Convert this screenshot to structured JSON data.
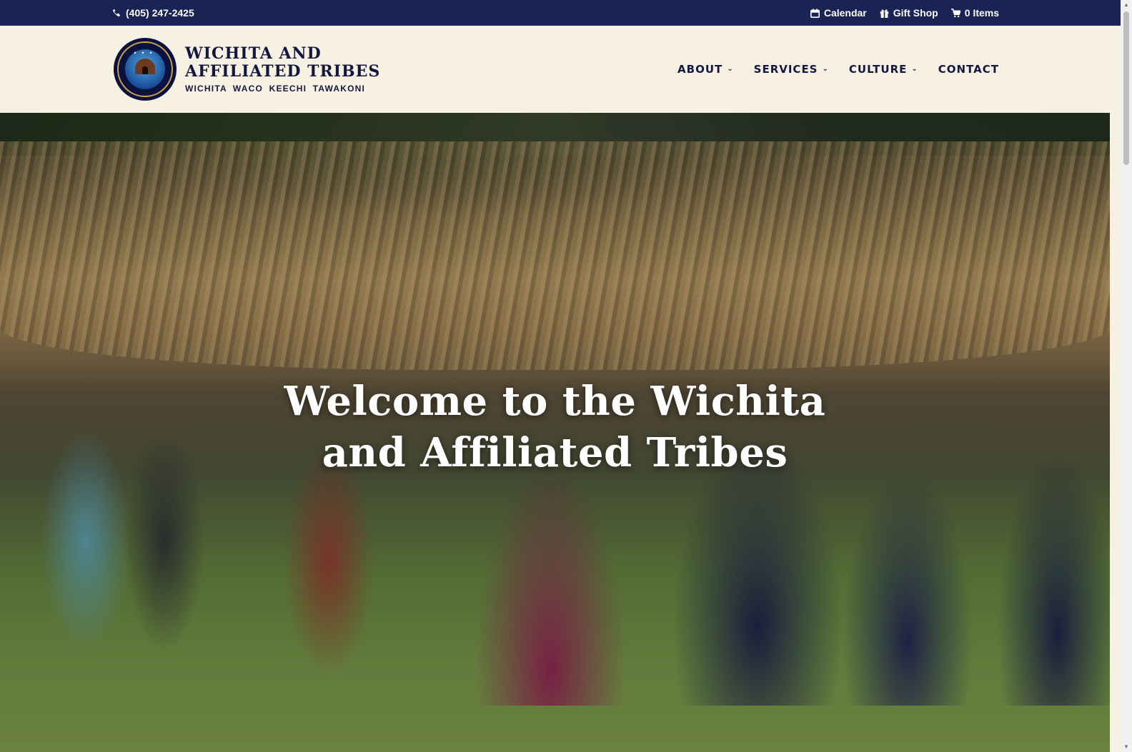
{
  "topbar": {
    "phone": "(405) 247-2425",
    "phone_icon": "phone-icon",
    "links": [
      {
        "label": "Calendar",
        "icon": "calendar-icon"
      },
      {
        "label": "Gift Shop",
        "icon": "gift-icon"
      },
      {
        "label": "0 Items",
        "icon": "cart-icon"
      }
    ],
    "bg_color": "#1a2356"
  },
  "header": {
    "logo": {
      "line1": "WICHITA AND",
      "line2": "AFFILIATED TRIBES",
      "tagline": "WICHITA  WACO  KEECHI  TAWAKONI",
      "seal_icon": "tribal-seal-icon"
    },
    "nav": [
      {
        "label": "ABOUT",
        "has_dropdown": true
      },
      {
        "label": "SERVICES",
        "has_dropdown": true
      },
      {
        "label": "CULTURE",
        "has_dropdown": true
      },
      {
        "label": "CONTACT",
        "has_dropdown": false
      }
    ],
    "bg_color": "#f7f1e3"
  },
  "hero": {
    "title_line1": "Welcome to the Wichita",
    "title_line2": "and Affiliated Tribes"
  }
}
